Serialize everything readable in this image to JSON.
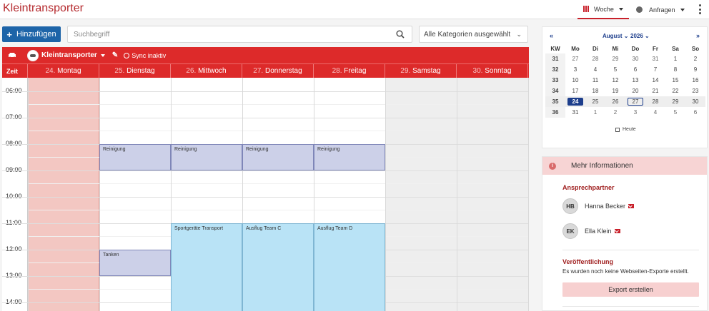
{
  "app": {
    "title": "Kleintransporter"
  },
  "topnav": {
    "view_label": "Woche",
    "requests_label": "Anfragen"
  },
  "toolbar": {
    "add_label": "Hinzufügen",
    "search_placeholder": "Suchbegriff",
    "category_label": "Alle Kategorien ausgewählt"
  },
  "calendar": {
    "resource_name": "Kleintransporter",
    "sync_label": "Sync inaktiv",
    "time_header": "Zeit",
    "days": [
      {
        "num": "24.",
        "name": "Montag"
      },
      {
        "num": "25.",
        "name": "Dienstag"
      },
      {
        "num": "26.",
        "name": "Mittwoch"
      },
      {
        "num": "27.",
        "name": "Donnerstag"
      },
      {
        "num": "28.",
        "name": "Freitag"
      },
      {
        "num": "29.",
        "name": "Samstag"
      },
      {
        "num": "30.",
        "name": "Sonntag"
      }
    ],
    "times": [
      "06:00",
      "07:00",
      "08:00",
      "09:00",
      "10:00",
      "11:00",
      "12:00",
      "13:00",
      "14:00"
    ],
    "events": [
      {
        "title": "Reinigung",
        "day": 1,
        "start": "08:00",
        "end": "09:00",
        "style": "grey"
      },
      {
        "title": "Reinigung",
        "day": 2,
        "start": "08:00",
        "end": "09:00",
        "style": "grey"
      },
      {
        "title": "Reinigung",
        "day": 3,
        "start": "08:00",
        "end": "09:00",
        "style": "grey"
      },
      {
        "title": "Reinigung",
        "day": 4,
        "start": "08:00",
        "end": "09:00",
        "style": "grey"
      },
      {
        "title": "Tanken",
        "day": 1,
        "start": "12:00",
        "end": "13:00",
        "style": "grey"
      },
      {
        "title": "Sportgeräte Transport",
        "day": 2,
        "start": "11:00",
        "end": "14:30",
        "style": "blue"
      },
      {
        "title": "Ausflug Team C",
        "day": 3,
        "start": "11:00",
        "end": "14:30",
        "style": "blue"
      },
      {
        "title": "Ausflug Team D",
        "day": 4,
        "start": "11:00",
        "end": "14:30",
        "style": "blue"
      }
    ]
  },
  "mini_calendar": {
    "prev": "«",
    "next": "»",
    "month": "August",
    "year": "2026",
    "headers": [
      "KW",
      "Mo",
      "Di",
      "Mi",
      "Do",
      "Fr",
      "Sa",
      "So"
    ],
    "rows": [
      [
        "31",
        "27",
        "28",
        "29",
        "30",
        "31",
        "1",
        "2"
      ],
      [
        "32",
        "3",
        "4",
        "5",
        "6",
        "7",
        "8",
        "9"
      ],
      [
        "33",
        "10",
        "11",
        "12",
        "13",
        "14",
        "15",
        "16"
      ],
      [
        "34",
        "17",
        "18",
        "19",
        "20",
        "21",
        "22",
        "23"
      ],
      [
        "35",
        "24",
        "25",
        "26",
        "27",
        "28",
        "29",
        "30"
      ],
      [
        "36",
        "31",
        "1",
        "2",
        "3",
        "4",
        "5",
        "6"
      ]
    ],
    "today_label": "Heute"
  },
  "info": {
    "title": "Mehr Informationen",
    "contacts_title": "Ansprechpartner",
    "contacts": [
      {
        "initials": "HB",
        "name": "Hanna Becker"
      },
      {
        "initials": "EK",
        "name": "Ella Klein"
      }
    ],
    "publication_title": "Veröffentlichung",
    "publication_text": "Es wurden noch keine Webseiten-Exporte erstellt.",
    "export_label": "Export erstellen"
  },
  "colors": {
    "accent": "#dd2a2a",
    "brand_title": "#b52a2e",
    "primary_button": "#1d64a8",
    "event_grey": "#ccd0e8",
    "event_blue": "#b9e3f6"
  }
}
